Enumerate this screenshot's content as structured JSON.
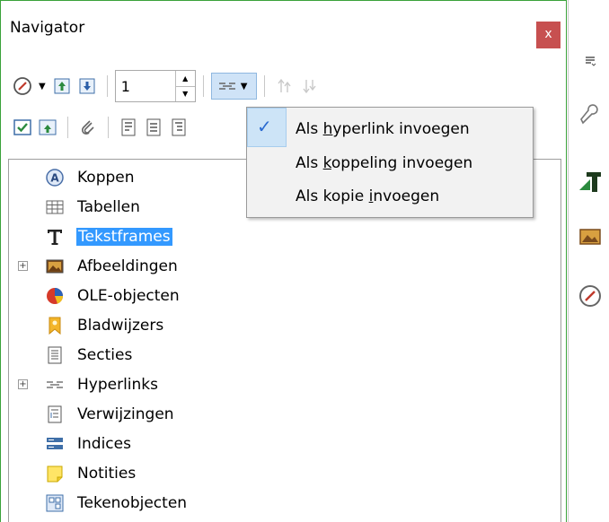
{
  "navigator": {
    "title": "Navigator",
    "close_glyph": "x",
    "toolbar1": {
      "page_number": "1"
    },
    "menu": {
      "items": [
        {
          "prefix": "Als ",
          "mnemonic": "h",
          "suffix": "yperlink invoegen",
          "checked": true
        },
        {
          "prefix": "Als ",
          "mnemonic": "k",
          "suffix": "oppeling invoegen",
          "checked": false
        },
        {
          "prefix": "Als kopie ",
          "mnemonic": "i",
          "suffix": "nvoegen",
          "checked": false
        }
      ]
    },
    "tree": {
      "items": [
        {
          "label": "Koppen",
          "icon": "headings-icon",
          "expandable": false
        },
        {
          "label": "Tabellen",
          "icon": "tables-icon",
          "expandable": false
        },
        {
          "label": "Tekstframes",
          "icon": "text-frames-icon",
          "expandable": false,
          "selected": true
        },
        {
          "label": "Afbeeldingen",
          "icon": "images-icon",
          "expandable": true
        },
        {
          "label": "OLE-objecten",
          "icon": "ole-objects-icon",
          "expandable": false
        },
        {
          "label": "Bladwijzers",
          "icon": "bookmarks-icon",
          "expandable": false
        },
        {
          "label": "Secties",
          "icon": "sections-icon",
          "expandable": false
        },
        {
          "label": "Hyperlinks",
          "icon": "hyperlinks-icon",
          "expandable": true
        },
        {
          "label": "Verwijzingen",
          "icon": "references-icon",
          "expandable": false
        },
        {
          "label": "Indices",
          "icon": "indexes-icon",
          "expandable": false
        },
        {
          "label": "Notities",
          "icon": "comments-icon",
          "expandable": false
        },
        {
          "label": "Tekenobjecten",
          "icon": "drawing-objects-icon",
          "expandable": false
        }
      ]
    },
    "expand_glyph": "+"
  },
  "colors": {
    "accent_border": "#3aa23a",
    "selection": "#3399ff",
    "close_bg": "#c75050"
  }
}
